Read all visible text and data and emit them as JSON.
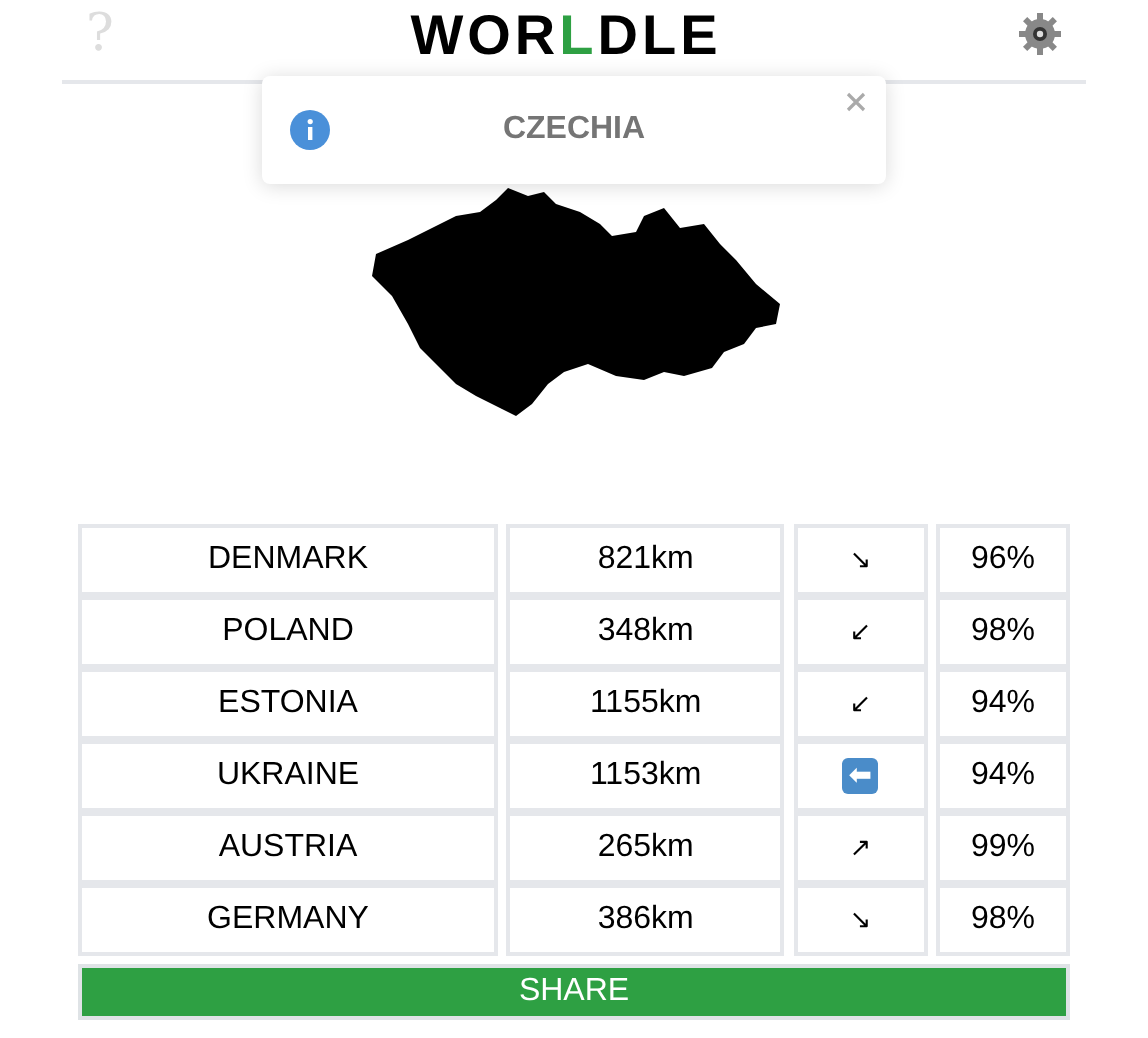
{
  "header": {
    "title_parts": [
      {
        "text": "WOR",
        "color": "#000000"
      },
      {
        "text": "L",
        "color": "#2ea043"
      },
      {
        "text": "DLE",
        "color": "#000000"
      }
    ],
    "help": "?"
  },
  "toast": {
    "message": "CZECHIA"
  },
  "guesses": [
    {
      "country": "DENMARK",
      "distance": "821km",
      "direction": "↘",
      "kind": "plain",
      "proximity": "96%"
    },
    {
      "country": "POLAND",
      "distance": "348km",
      "direction": "↙",
      "kind": "plain",
      "proximity": "98%"
    },
    {
      "country": "ESTONIA",
      "distance": "1155km",
      "direction": "↙",
      "kind": "plain",
      "proximity": "94%"
    },
    {
      "country": "UKRAINE",
      "distance": "1153km",
      "direction": "⬅",
      "kind": "boxed",
      "proximity": "94%"
    },
    {
      "country": "AUSTRIA",
      "distance": "265km",
      "direction": "↗",
      "kind": "plain",
      "proximity": "99%"
    },
    {
      "country": "GERMANY",
      "distance": "386km",
      "direction": "↘",
      "kind": "plain",
      "proximity": "98%"
    }
  ],
  "share_button": "SHARE"
}
